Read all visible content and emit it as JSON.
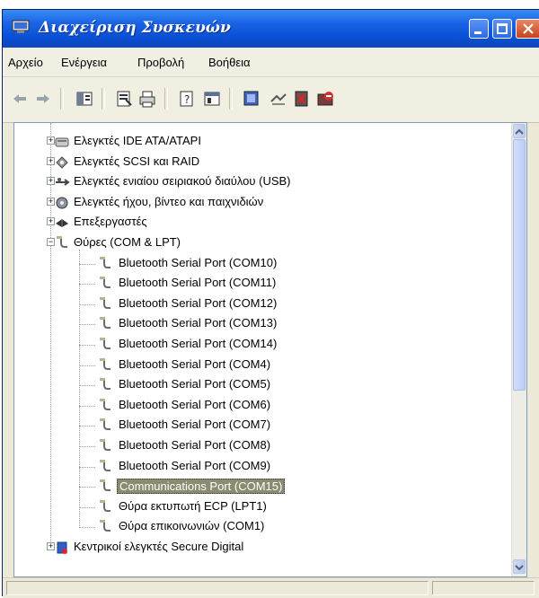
{
  "window": {
    "title": "Διαχείριση Συσκευών"
  },
  "menu": {
    "items": [
      "Αρχείο",
      "Ενέργεια",
      "Προβολή",
      "Βοήθεια"
    ]
  },
  "toolbar": {
    "buttons": [
      "back-icon",
      "forward-icon",
      "show-hide-tree-icon",
      "properties-icon",
      "print-icon",
      "help-icon",
      "console-icon",
      "scan-hardware-icon",
      "update-driver-icon",
      "uninstall-icon",
      "disable-icon"
    ]
  },
  "tree": {
    "categories": [
      {
        "label": "Ελεγκτές IDE ATA/ATAPI",
        "expanded": false,
        "icon": "ide-controller-icon"
      },
      {
        "label": "Ελεγκτές SCSI και RAID",
        "expanded": false,
        "icon": "scsi-controller-icon"
      },
      {
        "label": "Ελεγκτές ενιαίου σειριακού διαύλου (USB)",
        "expanded": false,
        "icon": "usb-controller-icon"
      },
      {
        "label": "Ελεγκτές ήχου, βίντεο και παιχνιδιών",
        "expanded": false,
        "icon": "sound-icon"
      },
      {
        "label": "Επεξεργαστές",
        "expanded": false,
        "icon": "processor-icon"
      },
      {
        "label": "Θύρες (COM & LPT)",
        "expanded": true,
        "icon": "port-icon"
      },
      {
        "label": "Κεντρικοί ελεγκτές Secure Digital",
        "expanded": false,
        "icon": "sd-host-icon"
      }
    ],
    "ports": [
      "Bluetooth Serial Port (COM10)",
      "Bluetooth Serial Port (COM11)",
      "Bluetooth Serial Port (COM12)",
      "Bluetooth Serial Port (COM13)",
      "Bluetooth Serial Port (COM14)",
      "Bluetooth Serial Port (COM4)",
      "Bluetooth Serial Port (COM5)",
      "Bluetooth Serial Port (COM6)",
      "Bluetooth Serial Port (COM7)",
      "Bluetooth Serial Port (COM8)",
      "Bluetooth Serial Port (COM9)",
      "Communications Port (COM15)",
      "Θύρα εκτυπωτή ECP (LPT1)",
      "Θύρα επικοινωνιών (COM1)"
    ],
    "selected": "Communications Port (COM15)"
  },
  "colors": {
    "title_bar": "#0b51d6",
    "selection": "#8b8b70",
    "window_bg": "#ece9d8"
  }
}
